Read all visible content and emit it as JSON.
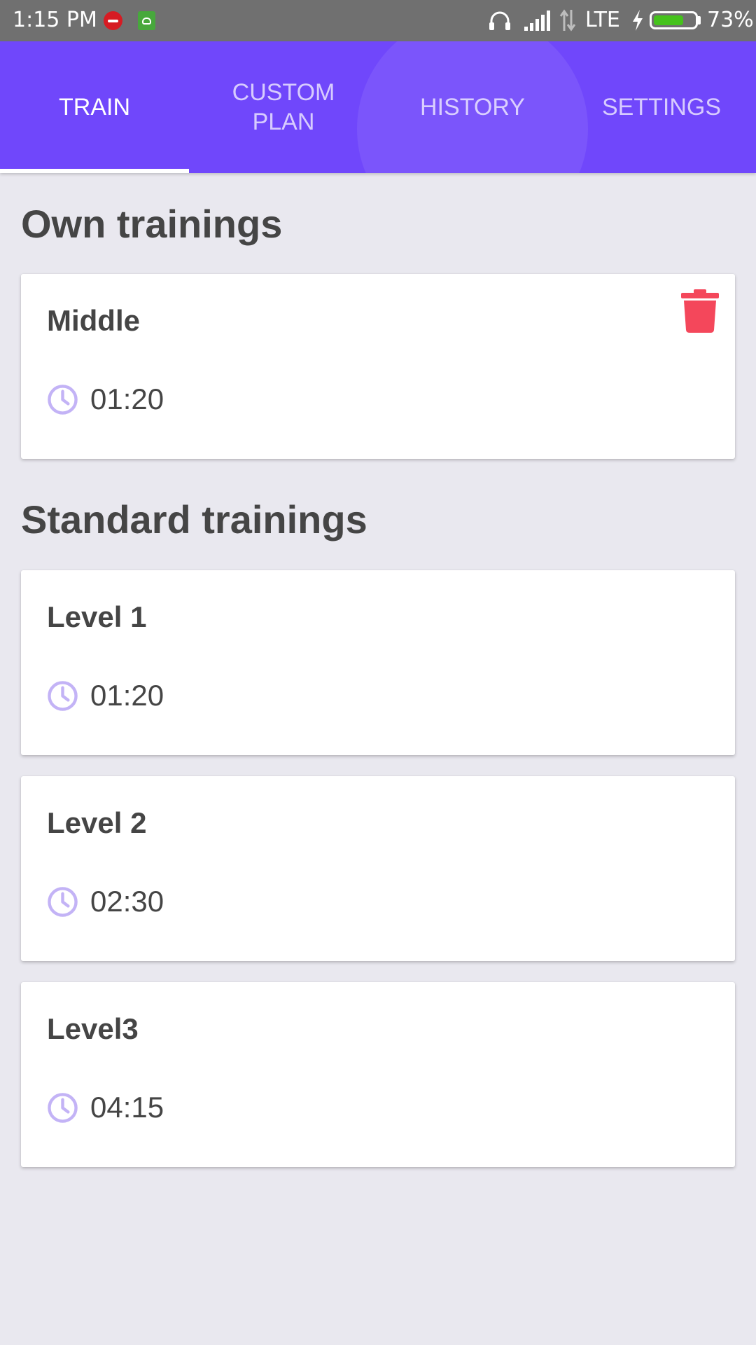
{
  "status_bar": {
    "time": "1:15 PM",
    "network": "LTE",
    "battery": "73%",
    "battery_level": 0.73,
    "icons": [
      "recording-notification-icon",
      "android-notification-icon",
      "headphones-icon",
      "signal-icon",
      "data-arrows-icon",
      "charging-icon",
      "battery-icon"
    ]
  },
  "tabs": [
    {
      "label_line1": "TRAIN",
      "label_line2": "",
      "active": true
    },
    {
      "label_line1": "CUSTOM",
      "label_line2": "PLAN",
      "active": false
    },
    {
      "label_line1": "HISTORY",
      "label_line2": "",
      "active": false
    },
    {
      "label_line1": "SETTINGS",
      "label_line2": "",
      "active": false
    }
  ],
  "own": {
    "title": "Own trainings",
    "items": [
      {
        "name": "Middle",
        "duration": "01:20",
        "deletable": true
      }
    ]
  },
  "standard": {
    "title": "Standard trainings",
    "items": [
      {
        "name": "Level 1",
        "duration": "01:20"
      },
      {
        "name": "Level 2",
        "duration": "02:30"
      },
      {
        "name": "Level3",
        "duration": "04:15"
      }
    ]
  },
  "colors": {
    "primary": "#7047fb",
    "background": "#e9e8ef",
    "clock_icon": "#c3b3f6",
    "delete_icon": "#f4475b",
    "text": "#454545"
  }
}
